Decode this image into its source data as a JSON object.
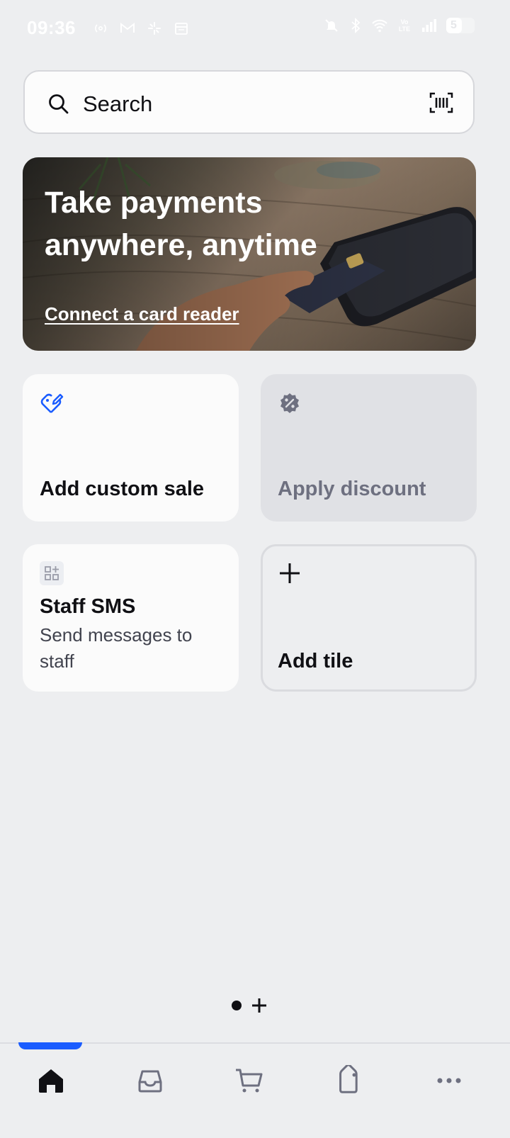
{
  "status_bar": {
    "time": "09:36",
    "left_icons": [
      "hotspot-icon",
      "gmail-icon",
      "pinwheel-icon",
      "calendar-icon"
    ],
    "right_icons": [
      "mute-icon",
      "bluetooth-icon",
      "wifi-icon",
      "volte-icon",
      "signal-icon",
      "battery-icon"
    ],
    "battery_level": "5",
    "volte_text": "Vo LTE"
  },
  "search": {
    "placeholder": "Search",
    "icon": "search-icon",
    "scan_icon": "barcode-scan-icon"
  },
  "banner": {
    "title": "Take payments anywhere, anytime",
    "link": "Connect a card reader"
  },
  "tiles": [
    {
      "label": "Add custom sale",
      "icon": "tag-edit-icon",
      "accent": "#1a5cff"
    },
    {
      "label": "Apply discount",
      "icon": "discount-badge-icon",
      "disabled": true
    },
    {
      "label": "Staff SMS",
      "subtitle": "Send messages to staff",
      "icon": "app-grid-icon"
    },
    {
      "label": "Add tile",
      "icon": "plus-icon"
    }
  ],
  "bottom_nav": {
    "items": [
      "home-icon",
      "inbox-icon",
      "cart-icon",
      "tag-icon",
      "more-icon"
    ],
    "active": "home-icon",
    "accent": "#1a5cff"
  },
  "colors": {
    "background": "#edeef0",
    "tile": "#fbfbfb",
    "disabled_tile": "#e0e1e5",
    "accent": "#1a5cff"
  }
}
